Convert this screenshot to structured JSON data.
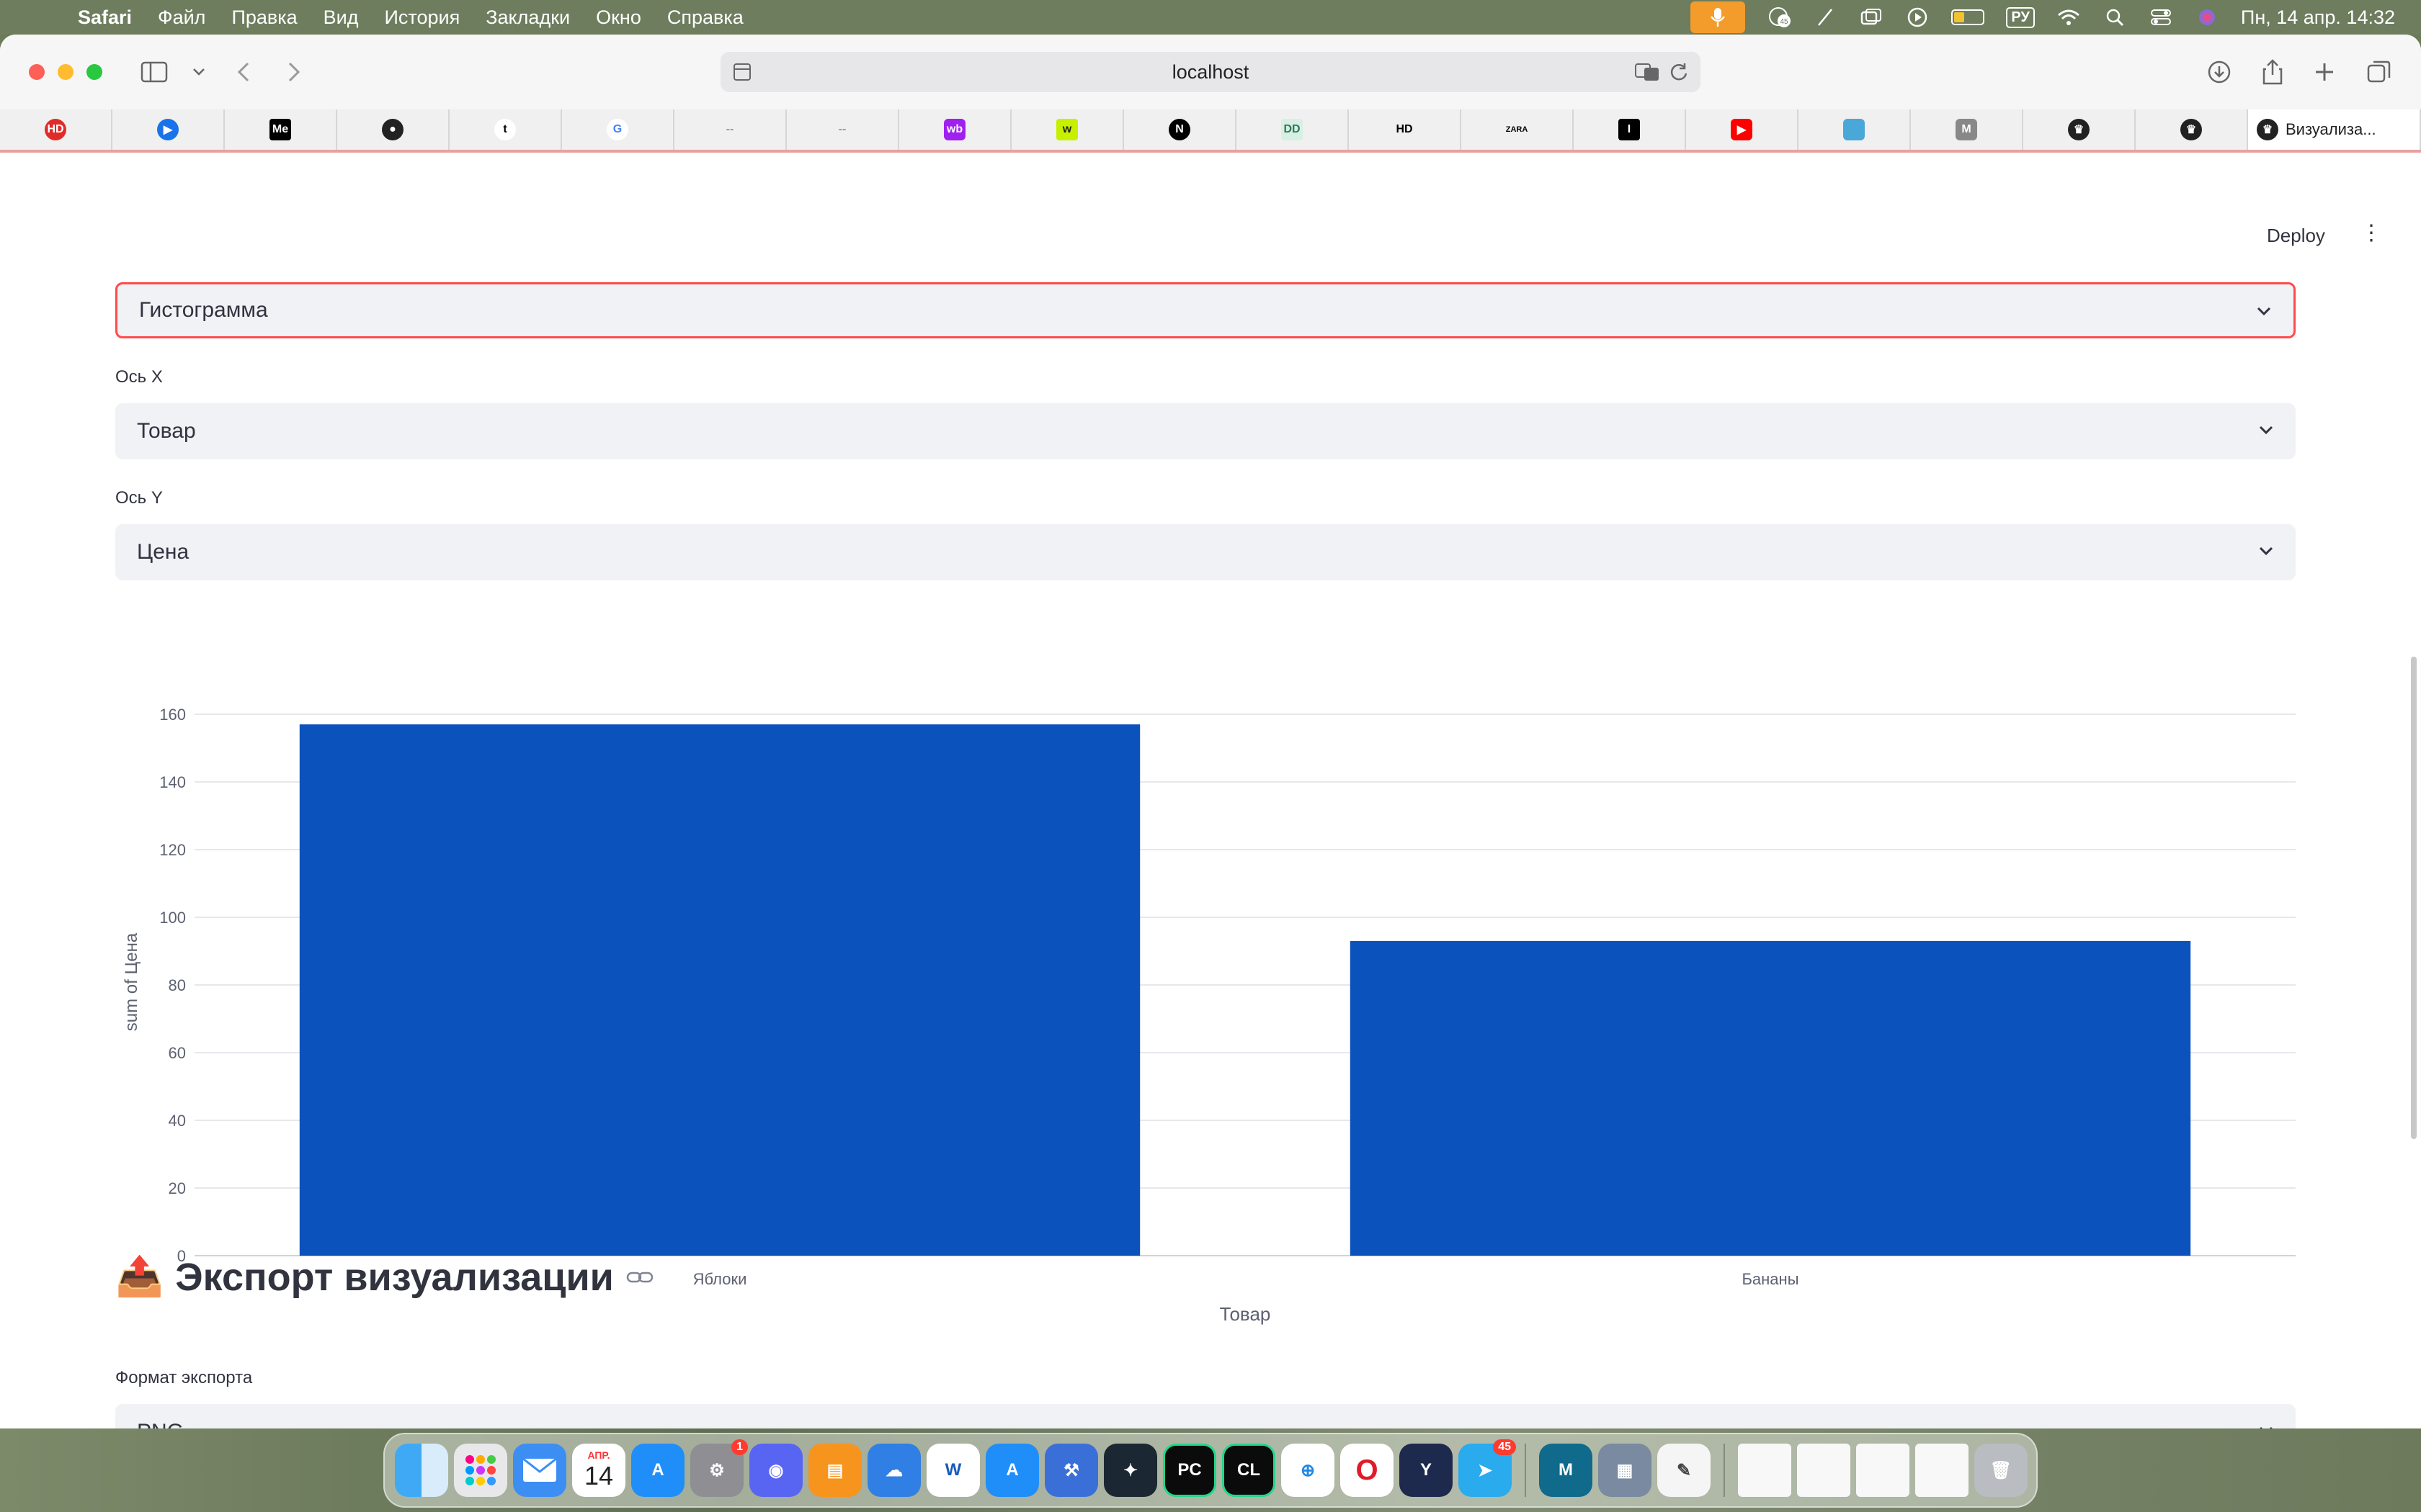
{
  "menubar": {
    "app": "Safari",
    "items": [
      "Файл",
      "Правка",
      "Вид",
      "История",
      "Закладки",
      "Окно",
      "Справка"
    ],
    "lang": "РУ",
    "notif_count": "45",
    "datetime": "Пн, 14 апр.  14:32"
  },
  "browser": {
    "url": "localhost",
    "active_tab": "Визуализа...",
    "favorites": [
      "HD",
      "play",
      "Me",
      "github",
      "t",
      "G",
      "--",
      "--",
      "wb",
      "w",
      "N",
      "DD",
      "HD",
      "ZARA",
      "I",
      "youtube",
      "box",
      "M",
      "crown",
      "crown"
    ]
  },
  "app": {
    "deploy_label": "Deploy",
    "chart_type_value": "Гистограмма",
    "x_axis_label": "Ось X",
    "x_axis_value": "Товар",
    "y_axis_label": "Ось Y",
    "y_axis_value": "Цена",
    "export_heading": "Экспорт визуализации",
    "export_heading_emoji": "📤",
    "export_format_label": "Формат экспорта",
    "export_format_value": "PNG"
  },
  "chart_data": {
    "type": "bar",
    "categories": [
      "Яблоки",
      "Бананы"
    ],
    "values": [
      157,
      93
    ],
    "xlabel": "Товар",
    "ylabel": "sum of Цена",
    "ylim": [
      0,
      160
    ],
    "yticks": [
      0,
      20,
      40,
      60,
      80,
      100,
      120,
      140,
      160
    ],
    "bar_color": "#0b52bd",
    "grid": true
  },
  "dock": {
    "calendar_month": "АПР.",
    "calendar_day": "14",
    "settings_badge": "1",
    "telegram_badge": "45"
  },
  "colors": {
    "accent": "#ff4b4b",
    "bar": "#0b52bd",
    "text": "#31333f"
  }
}
